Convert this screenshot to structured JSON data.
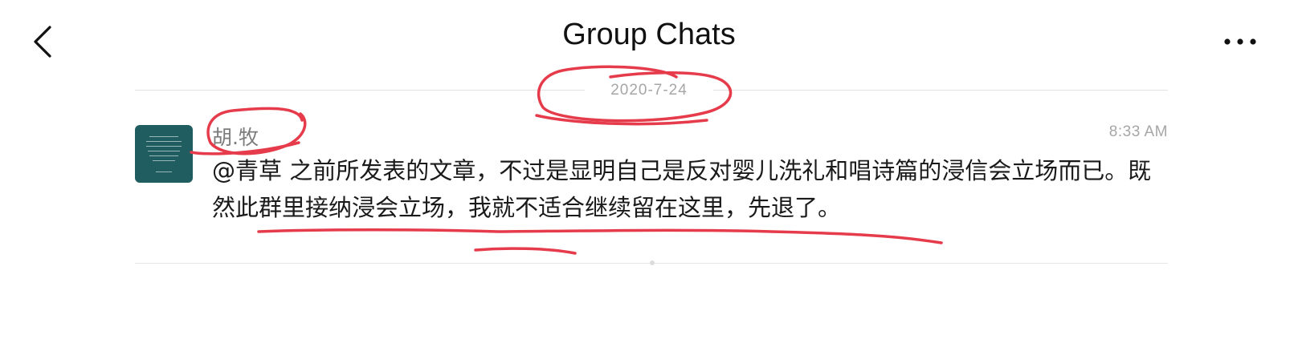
{
  "header": {
    "title": "Group Chats",
    "back_icon": "chevron-left-icon",
    "more_icon": "ellipsis-icon"
  },
  "chat": {
    "date": "2020-7-24",
    "message": {
      "sender": "胡.牧",
      "time": "8:33 AM",
      "text": "@青草 之前所发表的文章，不过是显明自己是反对婴儿洗礼和唱诗篇的浸信会立场而已。既然此群里接纳浸会立场，我就不适合继续留在这里，先退了。"
    }
  },
  "colors": {
    "annotation": "#e53b4b",
    "avatar_bg": "#1f5d60",
    "muted_text": "#a6a6a6"
  }
}
